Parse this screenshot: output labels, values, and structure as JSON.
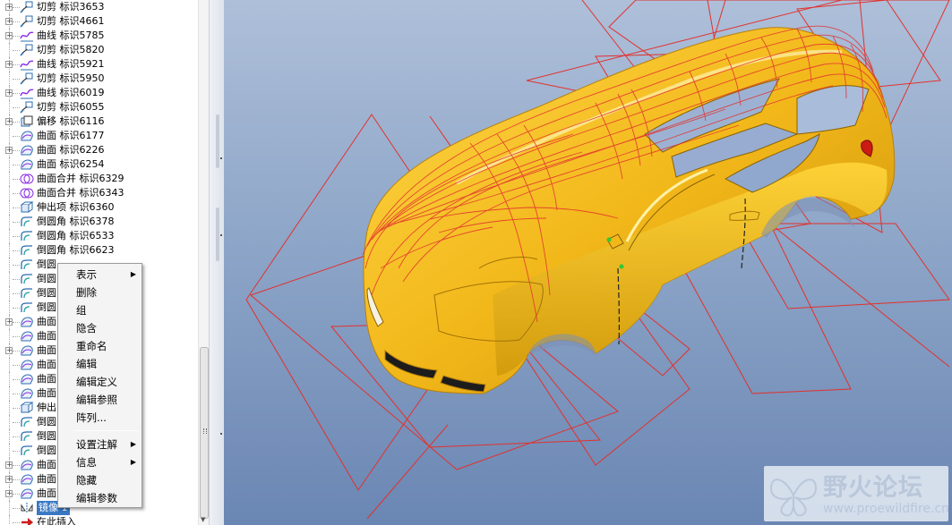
{
  "model_tree": {
    "items": [
      {
        "type": "切剪",
        "id": "标识3653",
        "icon": "cut-icon",
        "expandable": true
      },
      {
        "type": "切剪",
        "id": "标识4661",
        "icon": "cut-icon",
        "expandable": true
      },
      {
        "type": "曲线",
        "id": "标识5785",
        "icon": "curve-icon",
        "expandable": true
      },
      {
        "type": "切剪",
        "id": "标识5820",
        "icon": "cut-icon",
        "expandable": false
      },
      {
        "type": "曲线",
        "id": "标识5921",
        "icon": "curve-icon",
        "expandable": true
      },
      {
        "type": "切剪",
        "id": "标识5950",
        "icon": "cut-icon",
        "expandable": false
      },
      {
        "type": "曲线",
        "id": "标识6019",
        "icon": "curve-icon",
        "expandable": true
      },
      {
        "type": "切剪",
        "id": "标识6055",
        "icon": "cut-icon",
        "expandable": false
      },
      {
        "type": "偏移",
        "id": "标识6116",
        "icon": "offset-icon",
        "expandable": true
      },
      {
        "type": "曲面",
        "id": "标识6177",
        "icon": "surface-icon",
        "expandable": false
      },
      {
        "type": "曲面",
        "id": "标识6226",
        "icon": "surface-icon",
        "expandable": true
      },
      {
        "type": "曲面",
        "id": "标识6254",
        "icon": "surface-icon",
        "expandable": false
      },
      {
        "type": "曲面合并",
        "id": "标识6329",
        "icon": "merge-icon",
        "expandable": false
      },
      {
        "type": "曲面合并",
        "id": "标识6343",
        "icon": "merge-icon",
        "expandable": false
      },
      {
        "type": "伸出项",
        "id": "标识6360",
        "icon": "protrusion-icon",
        "expandable": false
      },
      {
        "type": "倒圆角",
        "id": "标识6378",
        "icon": "round-icon",
        "expandable": false
      },
      {
        "type": "倒圆角",
        "id": "标识6533",
        "icon": "round-icon",
        "expandable": false
      },
      {
        "type": "倒圆角",
        "id": "标识6623",
        "icon": "round-icon",
        "expandable": false
      },
      {
        "type": "倒圆",
        "id": "",
        "icon": "round-icon",
        "expandable": false
      },
      {
        "type": "倒圆",
        "id": "",
        "icon": "round-icon",
        "expandable": false
      },
      {
        "type": "倒圆",
        "id": "",
        "icon": "round-icon",
        "expandable": false
      },
      {
        "type": "倒圆",
        "id": "",
        "icon": "round-icon",
        "expandable": false
      },
      {
        "type": "曲面",
        "id": "",
        "icon": "surface-icon",
        "expandable": true
      },
      {
        "type": "曲面",
        "id": "",
        "icon": "surface-icon",
        "expandable": false
      },
      {
        "type": "曲面",
        "id": "",
        "icon": "surface-icon",
        "expandable": true
      },
      {
        "type": "曲面",
        "id": "",
        "icon": "surface-icon",
        "expandable": false
      },
      {
        "type": "曲面",
        "id": "",
        "icon": "surface-icon",
        "expandable": false
      },
      {
        "type": "曲面",
        "id": "",
        "icon": "surface-icon",
        "expandable": false
      },
      {
        "type": "伸出",
        "id": "",
        "icon": "protrusion-icon",
        "expandable": false
      },
      {
        "type": "倒圆",
        "id": "",
        "icon": "round-icon",
        "expandable": false
      },
      {
        "type": "倒圆",
        "id": "",
        "icon": "round-icon",
        "expandable": false
      },
      {
        "type": "倒圆",
        "id": "",
        "icon": "round-icon",
        "expandable": false
      },
      {
        "type": "曲面",
        "id": "",
        "icon": "surface-icon",
        "expandable": true
      },
      {
        "type": "曲面",
        "id": "",
        "icon": "surface-icon",
        "expandable": true
      },
      {
        "type": "曲面",
        "id": "",
        "icon": "surface-icon",
        "expandable": true
      },
      {
        "type": "镜像 1",
        "id": "",
        "icon": "mirror-icon",
        "expandable": false,
        "selected": true
      },
      {
        "type": "在此插入",
        "id": "",
        "icon": "insert-here-icon",
        "expandable": false
      }
    ]
  },
  "context_menu": {
    "items": [
      {
        "label": "表示",
        "submenu": true
      },
      {
        "label": "删除",
        "submenu": false
      },
      {
        "label": "组",
        "submenu": false
      },
      {
        "label": "隐含",
        "submenu": false
      },
      {
        "label": "重命名",
        "submenu": false
      },
      {
        "label": "编辑",
        "submenu": false
      },
      {
        "label": "编辑定义",
        "submenu": false
      },
      {
        "label": "编辑参照",
        "submenu": false
      },
      {
        "label": "阵列...",
        "submenu": false
      },
      {
        "separator": true
      },
      {
        "label": "设置注解",
        "submenu": true
      },
      {
        "label": "信息",
        "submenu": true
      },
      {
        "label": "隐藏",
        "submenu": false
      },
      {
        "label": "编辑参数",
        "submenu": false
      }
    ]
  },
  "watermark": {
    "title": "野火论坛",
    "url": "www.proewildfire.cn"
  },
  "colors": {
    "viewport_top": "#aebfd9",
    "viewport_bottom": "#6a86b3",
    "car_body": "#f2b81a",
    "car_shade": "#c98e08",
    "wire": "#e2312d",
    "selection": "#3a78c4"
  }
}
